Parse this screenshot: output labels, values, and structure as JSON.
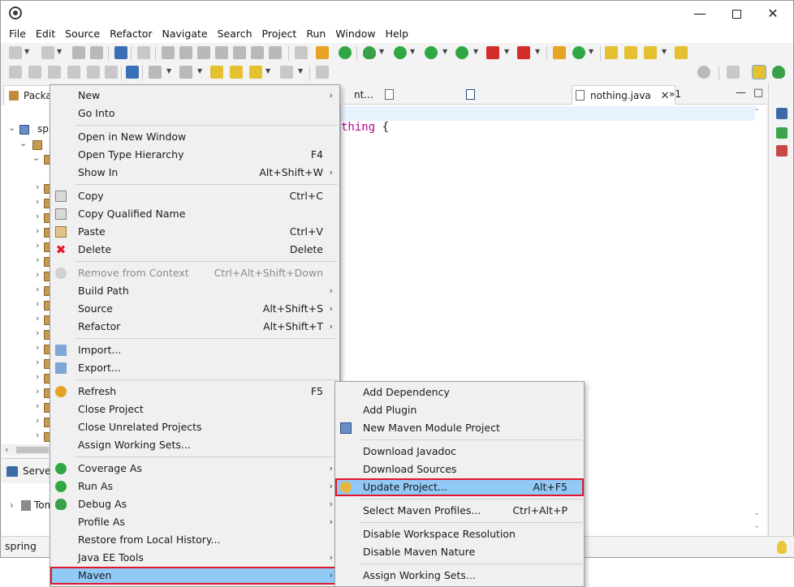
{
  "menubar": [
    "File",
    "Edit",
    "Source",
    "Refactor",
    "Navigate",
    "Search",
    "Project",
    "Run",
    "Window",
    "Help"
  ],
  "left_view": {
    "tab_label": "Package Explorer",
    "root_label": "spr"
  },
  "servers_view": {
    "tab_label": "Servers",
    "row_label": "Tomcat"
  },
  "editor": {
    "tabs": [
      {
        "label": "nt..."
      },
      {
        "label": ""
      },
      {
        "label": ""
      },
      {
        "label": "nothing.java"
      }
    ],
    "overflow_label": "»1",
    "code_keyword": "thing",
    "code_rest": " {"
  },
  "status": {
    "text": "spring"
  },
  "context_menu": {
    "items": [
      {
        "label": "New",
        "accel": "",
        "submenu": true
      },
      {
        "label": "Go Into",
        "accel": ""
      },
      {
        "label": "Open in New Window",
        "accel": ""
      },
      {
        "label": "Open Type Hierarchy",
        "accel": "F4"
      },
      {
        "label": "Show In",
        "accel": "Alt+Shift+W",
        "submenu": true
      },
      {
        "label": "Copy",
        "accel": "Ctrl+C"
      },
      {
        "label": "Copy Qualified Name",
        "accel": ""
      },
      {
        "label": "Paste",
        "accel": "Ctrl+V"
      },
      {
        "label": "Delete",
        "accel": "Delete"
      },
      {
        "label": "Remove from Context",
        "accel": "Ctrl+Alt+Shift+Down",
        "disabled": true
      },
      {
        "label": "Build Path",
        "accel": "",
        "submenu": true
      },
      {
        "label": "Source",
        "accel": "Alt+Shift+S",
        "submenu": true
      },
      {
        "label": "Refactor",
        "accel": "Alt+Shift+T",
        "submenu": true
      },
      {
        "label": "Import...",
        "accel": ""
      },
      {
        "label": "Export...",
        "accel": ""
      },
      {
        "label": "Refresh",
        "accel": "F5"
      },
      {
        "label": "Close Project",
        "accel": ""
      },
      {
        "label": "Close Unrelated Projects",
        "accel": ""
      },
      {
        "label": "Assign Working Sets...",
        "accel": ""
      },
      {
        "label": "Coverage As",
        "accel": "",
        "submenu": true
      },
      {
        "label": "Run As",
        "accel": "",
        "submenu": true
      },
      {
        "label": "Debug As",
        "accel": "",
        "submenu": true
      },
      {
        "label": "Profile As",
        "accel": "",
        "submenu": true
      },
      {
        "label": "Restore from Local History...",
        "accel": ""
      },
      {
        "label": "Java EE Tools",
        "accel": "",
        "submenu": true
      },
      {
        "label": "Maven",
        "accel": "",
        "submenu": true,
        "highlighted": true
      }
    ]
  },
  "maven_submenu": {
    "items": [
      {
        "label": "Add Dependency",
        "accel": ""
      },
      {
        "label": "Add Plugin",
        "accel": ""
      },
      {
        "label": "New Maven Module Project",
        "accel": ""
      },
      {
        "label": "Download Javadoc",
        "accel": ""
      },
      {
        "label": "Download Sources",
        "accel": ""
      },
      {
        "label": "Update Project...",
        "accel": "Alt+F5",
        "highlighted": true
      },
      {
        "label": "Select Maven Profiles...",
        "accel": "Ctrl+Alt+P"
      },
      {
        "label": "Disable Workspace Resolution",
        "accel": ""
      },
      {
        "label": "Disable Maven Nature",
        "accel": ""
      },
      {
        "label": "Assign Working Sets...",
        "accel": ""
      }
    ]
  },
  "colors": {
    "highlight_fill": "#91c9f7",
    "highlight_border": "#e0172b",
    "keyword": "#b5008f"
  }
}
